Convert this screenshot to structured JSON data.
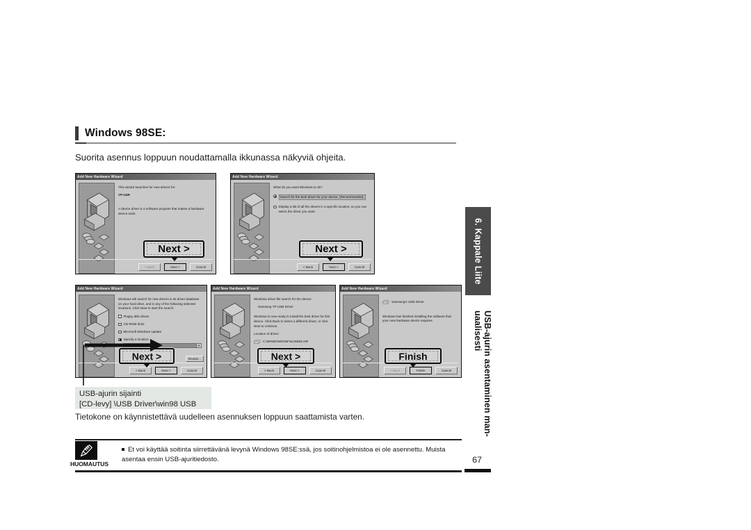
{
  "heading": {
    "title": "Windows 98SE:"
  },
  "intro": "Suorita asennus loppuun noudattamalla ikkunassa näkyviä ohjeita.",
  "dialogs": [
    {
      "title": "Add New Hardware Wizard",
      "line1": "This wizard searches for new drivers for:",
      "device": "YP-U2R",
      "line2": "A device driver is a software program that makes a hardware device work.",
      "magnified_button": "Next >",
      "buttons": [
        "< Back",
        "Next >",
        "Cancel"
      ],
      "focused_button": "Next >"
    },
    {
      "title": "Add New Hardware Wizard",
      "question": "What do you want Windows to do?",
      "option1": "Search for the best driver for your device. (Recommended).",
      "option2": "Display a list of all the drivers in a specific location, so you can select the driver you want.",
      "selected_option": "option1",
      "magnified_button": "Next >",
      "buttons": [
        "< Back",
        "Next >",
        "Cancel"
      ],
      "focused_button": "Next >"
    },
    {
      "title": "Add New Hardware Wizard",
      "line1": "Windows will search for new drivers in its driver database on your hard drive, and in any of the following selected locations. Click Next to start the search.",
      "checkboxes": [
        {
          "label": "Floppy disk drives",
          "checked": false
        },
        {
          "label": "CD-ROM drive",
          "checked": false
        },
        {
          "label": "Microsoft Windows Update",
          "checked": false
        },
        {
          "label": "Specify a location:",
          "checked": true
        }
      ],
      "location_value": "\\USB Driver\\win98 USB",
      "browse_label": "Browse...",
      "magnified_button": "Next >",
      "buttons": [
        "< Back",
        "Next >",
        "Cancel"
      ],
      "focused_button": "Next >"
    },
    {
      "title": "Add New Hardware Wizard",
      "line1": "Windows driver file search for the device:",
      "device": "Samsung YP USB Driver",
      "line2": "Windows is now ready to install the best driver for this device. Click Back to select a different driver, or click Next to continue.",
      "location_label": "Location of driver:",
      "location_path": "C:\\WINDOWS\\INF\\wUSB32.INF",
      "magnified_button": "Next >",
      "buttons": [
        "< Back",
        "Next >",
        "Cancel"
      ],
      "focused_button": "Next >"
    },
    {
      "title": "Add New Hardware Wizard",
      "device": "Samsung's USB Driver",
      "line2": "Windows has finished installing the software that your new hardware device requires.",
      "magnified_button": "Finish",
      "buttons": [
        "< Back",
        "Finish",
        "Cancel"
      ],
      "focused_button": "Finish"
    }
  ],
  "callout": {
    "line1": "USB-ajurin sijainti",
    "line2": "[CD-levy] \\USB Driver\\win98 USB"
  },
  "body_line": "Tietokone on käynnistettävä uudelleen asennuksen loppuun saattamista varten.",
  "note": {
    "icon_label": "HUOMAUTUS",
    "text": "Et voi käyttää soitinta siirrettävänä levynä Windows 98SE:ssä, jos soitinohjelmistoa ei ole asennettu. Muista asentaa ensin USB-ajuritiedosto."
  },
  "sidebar": {
    "tab_label": "6. Kappale Liite",
    "vertical_line1": "USB-ajurin asentaminen man-",
    "vertical_line2": "uaalisesti",
    "page_number": "67"
  },
  "colors": {
    "sidebar_tab": "#4b4b4b",
    "callout_bg": "#e3e8e4",
    "dialog_face": "#c9c9c9",
    "rule": "#8e8e8e"
  }
}
